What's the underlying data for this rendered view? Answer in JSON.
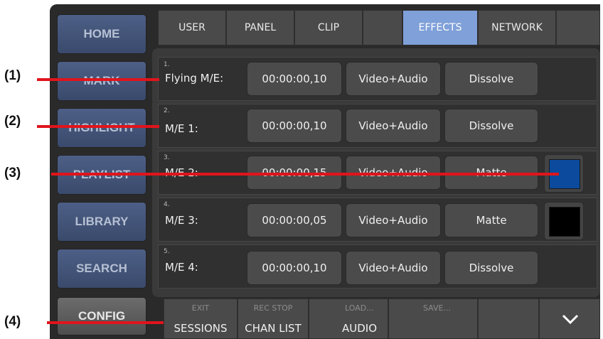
{
  "sidebar": {
    "items": [
      {
        "label": "HOME"
      },
      {
        "label": "MARK"
      },
      {
        "label": "HIGHLIGHT"
      },
      {
        "label": "PLAYLIST"
      },
      {
        "label": "LIBRARY"
      },
      {
        "label": "SEARCH"
      },
      {
        "label": "CONFIG"
      }
    ]
  },
  "tabs": [
    {
      "label": "USER"
    },
    {
      "label": "PANEL"
    },
    {
      "label": "CLIP"
    },
    {
      "label": "EFFECTS"
    },
    {
      "label": "NETWORK"
    }
  ],
  "effects": [
    {
      "num": "1.",
      "name": "Flying M/E:",
      "duration": "00:00:00,10",
      "mode": "Video+Audio",
      "transition": "Dissolve"
    },
    {
      "num": "2.",
      "name": "M/E 1:",
      "duration": "00:00:00,10",
      "mode": "Video+Audio",
      "transition": "Dissolve"
    },
    {
      "num": "3.",
      "name": "M/E 2:",
      "duration": "00:00:00,15",
      "mode": "Video+Audio",
      "transition": "Matte",
      "color": "#0b4a9c"
    },
    {
      "num": "4.",
      "name": "M/E 3:",
      "duration": "00:00:00,05",
      "mode": "Video+Audio",
      "transition": "Matte",
      "color": "#000000"
    },
    {
      "num": "5.",
      "name": "M/E 4:",
      "duration": "00:00:00,10",
      "mode": "Video+Audio",
      "transition": "Dissolve"
    }
  ],
  "bottom_bar": [
    {
      "top": "EXIT",
      "main": "SESSIONS"
    },
    {
      "top": "REC STOP",
      "main": "CHAN LIST"
    },
    {
      "top": "LOAD...",
      "main": "AUDIO"
    },
    {
      "top": "SAVE...",
      "main": ""
    },
    {
      "top": "",
      "main": ""
    }
  ],
  "bottom_scroll_icon": "chevron-down-icon",
  "callouts": [
    "(1)",
    "(2)",
    "(3)",
    "(4)"
  ],
  "colors": {
    "accent_tab": "#7fa0d8",
    "callout_line": "#e0141c",
    "sidebar_blue": "#4d5f86"
  }
}
